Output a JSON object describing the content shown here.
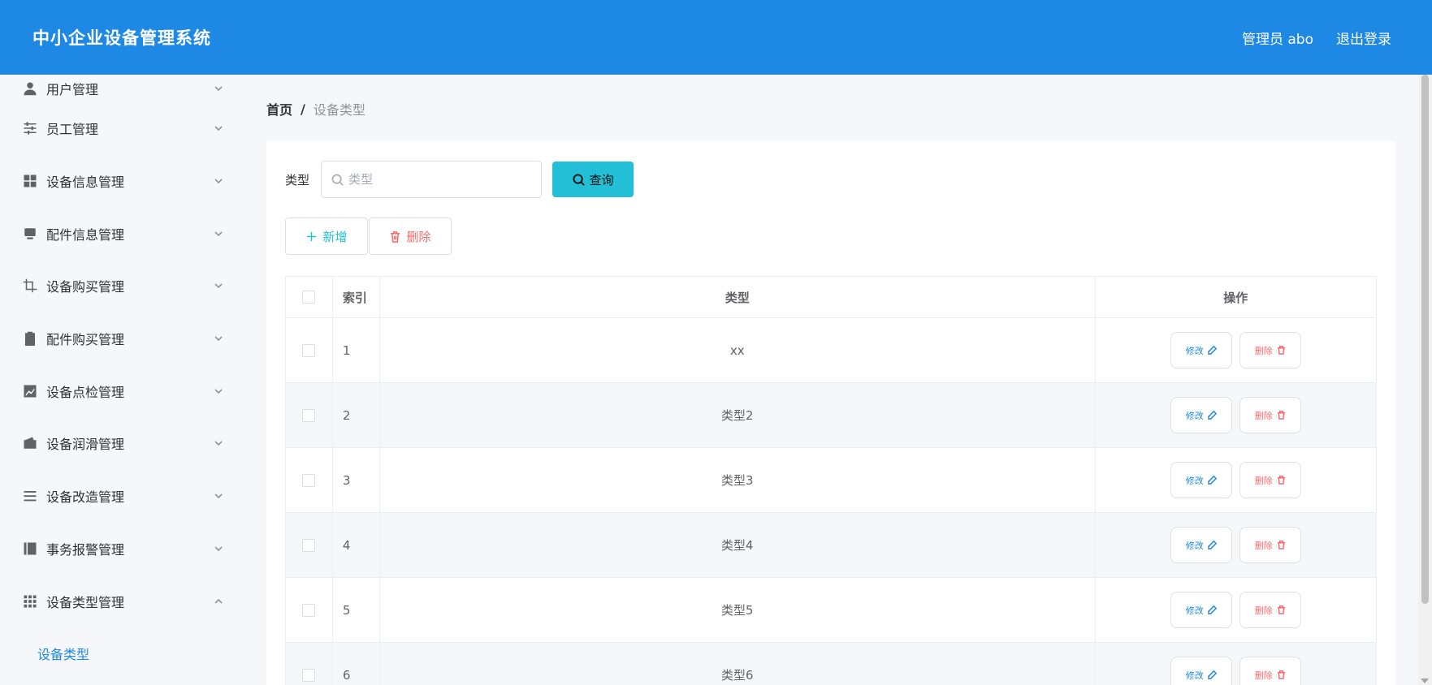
{
  "header": {
    "title": "中小企业设备管理系统",
    "user": "管理员 abo",
    "logout": "退出登录"
  },
  "sidebar": {
    "items": [
      {
        "label": "用户管理",
        "icon": "user-icon"
      },
      {
        "label": "员工管理",
        "icon": "sliders-icon"
      },
      {
        "label": "设备信息管理",
        "icon": "grid-icon"
      },
      {
        "label": "配件信息管理",
        "icon": "monitor-icon"
      },
      {
        "label": "设备购买管理",
        "icon": "crop-icon"
      },
      {
        "label": "配件购买管理",
        "icon": "clipboard-check-icon"
      },
      {
        "label": "设备点检管理",
        "icon": "chart-icon"
      },
      {
        "label": "设备润滑管理",
        "icon": "wallet-icon"
      },
      {
        "label": "设备改造管理",
        "icon": "list-icon"
      },
      {
        "label": "事务报警管理",
        "icon": "notebook-icon"
      },
      {
        "label": "设备类型管理",
        "icon": "apps-icon"
      }
    ],
    "active_sub": "设备类型"
  },
  "breadcrumb": {
    "home": "首页",
    "separator": "/",
    "current": "设备类型"
  },
  "search": {
    "label": "类型",
    "placeholder": "类型",
    "value": "",
    "query_label": "查询"
  },
  "actions": {
    "add_label": "新增",
    "delete_label": "删除"
  },
  "table": {
    "headers": {
      "index": "索引",
      "type": "类型",
      "ops": "操作"
    },
    "rows": [
      {
        "index": "1",
        "type": "xx"
      },
      {
        "index": "2",
        "type": "类型2"
      },
      {
        "index": "3",
        "type": "类型3"
      },
      {
        "index": "4",
        "type": "类型4"
      },
      {
        "index": "5",
        "type": "类型5"
      },
      {
        "index": "6",
        "type": "类型6"
      }
    ],
    "edit_label": "修改",
    "delete_label": "删除"
  },
  "colors": {
    "primary": "#1e88e5",
    "accent": "#22bfd6",
    "danger": "#f56c6c"
  }
}
